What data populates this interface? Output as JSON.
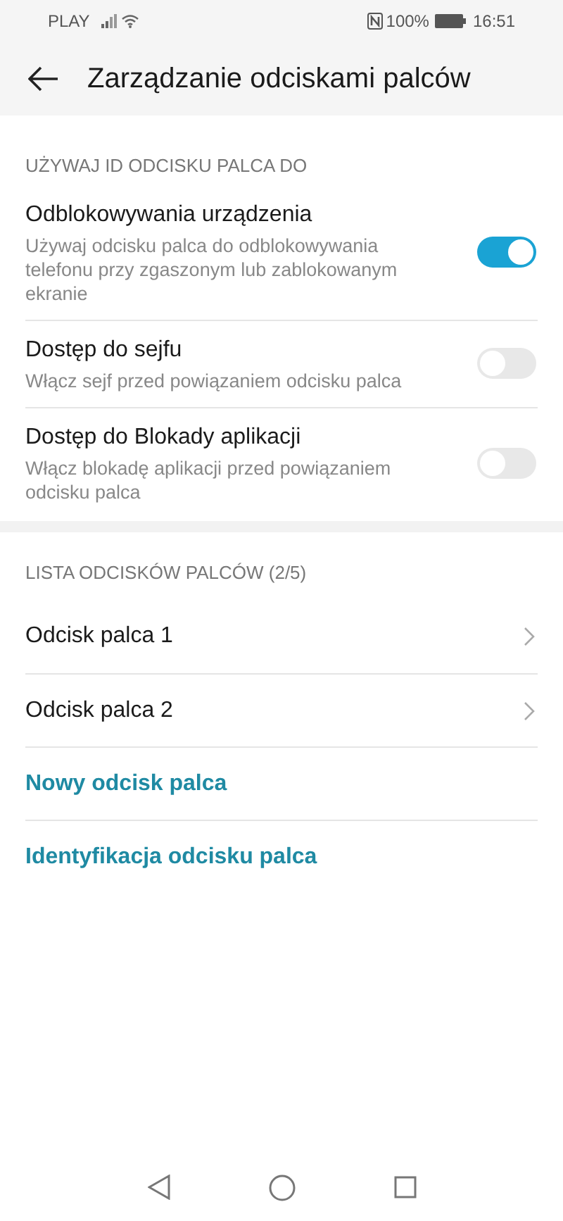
{
  "status_bar": {
    "carrier": "PLAY",
    "battery": "100%",
    "time": "16:51"
  },
  "header": {
    "title": "Zarządzanie odciskami palców"
  },
  "usage_section": {
    "heading": "UŻYWAJ ID ODCISKU PALCA DO",
    "settings": [
      {
        "title": "Odblokowywania urządzenia",
        "description": "Używaj odcisku palca do odblokowywania telefonu przy zgaszonym lub zablokowanym ekranie",
        "on": true
      },
      {
        "title": "Dostęp do sejfu",
        "description": "Włącz sejf przed powiązaniem odcisku palca",
        "on": false
      },
      {
        "title": "Dostęp do Blokady aplikacji",
        "description": "Włącz blokadę aplikacji przed powiązaniem odcisku palca",
        "on": false
      }
    ]
  },
  "fingerprint_section": {
    "heading": "LISTA ODCISKÓW PALCÓW (2/5)",
    "items": [
      {
        "kind": "fingerprint",
        "label": "Odcisk palca 1"
      },
      {
        "kind": "fingerprint",
        "label": "Odcisk palca 2"
      },
      {
        "kind": "action",
        "label": "Nowy odcisk palca"
      },
      {
        "kind": "action",
        "label": "Identyfikacja odcisku palca"
      }
    ]
  }
}
